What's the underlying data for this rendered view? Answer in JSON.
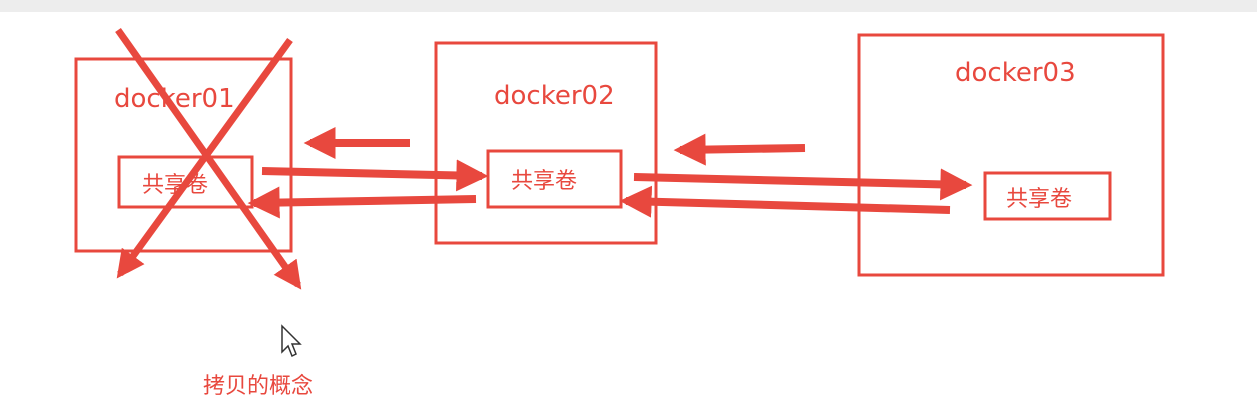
{
  "colors": {
    "accent": "#e8483e",
    "page_bg": "#ffffff",
    "top_strip": "#ededed",
    "cursor": "#ffffff"
  },
  "containers": [
    {
      "name": "docker01",
      "volume_label": "共享卷",
      "crossed_out": true
    },
    {
      "name": "docker02",
      "volume_label": "共享卷",
      "crossed_out": false
    },
    {
      "name": "docker03",
      "volume_label": "共享卷",
      "crossed_out": false
    }
  ],
  "caption": "拷贝的概念",
  "icons": {
    "cursor": "mouse-cursor-icon",
    "cross": "cross-out-icon"
  }
}
